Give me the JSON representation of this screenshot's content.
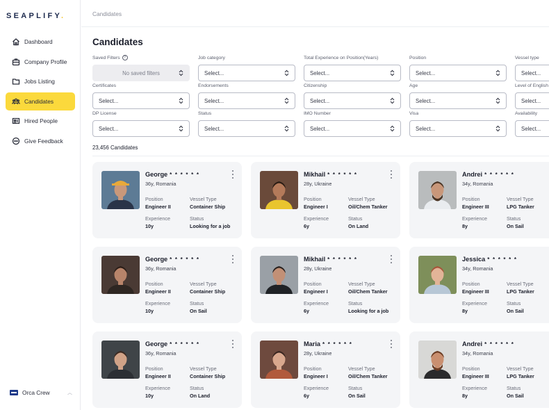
{
  "brand": {
    "name": "SEAPLIFY",
    "dot": "."
  },
  "sidebar": {
    "items": [
      {
        "label": "Dashboard",
        "icon": "home-icon"
      },
      {
        "label": "Company Profile",
        "icon": "briefcase-icon"
      },
      {
        "label": "Jobs Listing",
        "icon": "folder-icon"
      },
      {
        "label": "Candidates",
        "icon": "users-icon",
        "active": true
      },
      {
        "label": "Hired People",
        "icon": "id-card-icon"
      },
      {
        "label": "Give Feedback",
        "icon": "chat-bubble-icon"
      }
    ],
    "org": {
      "name": "Orca Crew",
      "logo": "orca-crew-logo"
    }
  },
  "breadcrumb": "Candidates",
  "page_title": "Candidates",
  "filters": {
    "saved": {
      "label": "Saved Filters",
      "value": "No saved filters"
    },
    "job_category": {
      "label": "Job category",
      "value": "Select..."
    },
    "total_experience": {
      "label": "Total Experience on Position(Years)",
      "value": "Select..."
    },
    "position": {
      "label": "Position",
      "value": "Select..."
    },
    "vessel_type": {
      "label": "Vessel type",
      "value": "Select..."
    },
    "certificates": {
      "label": "Certificates",
      "value": "Select..."
    },
    "endorsements": {
      "label": "Endorsements",
      "value": "Select..."
    },
    "citizenship": {
      "label": "Citizenship",
      "value": "Select..."
    },
    "age": {
      "label": "Age",
      "value": "Select..."
    },
    "english": {
      "label": "Level of English",
      "value": "Select..."
    },
    "dp_license": {
      "label": "DP License",
      "value": "Select..."
    },
    "status": {
      "label": "Status",
      "value": "Select..."
    },
    "imo_number": {
      "label": "IMO Number",
      "value": "Select..."
    },
    "visa": {
      "label": "Visa",
      "value": "Select..."
    },
    "availability": {
      "label": "Availability",
      "value": "Select..."
    }
  },
  "candidates_count": "23,456 Candidates",
  "field_labels": {
    "position": "Position",
    "vessel": "Vessel Type",
    "experience": "Experience",
    "status": "Status"
  },
  "mask": "* * * * * *",
  "candidates": [
    {
      "name": "George",
      "meta": "36y, Romania",
      "position": "Engineer II",
      "vessel": "Container Ship",
      "experience": "10y",
      "status": "Looking for a job"
    },
    {
      "name": "Mikhail",
      "meta": "28y, Ukraine",
      "position": "Engineer I",
      "vessel": "Oil/Chem Tanker",
      "experience": "6y",
      "status": "On Land"
    },
    {
      "name": "Andrei",
      "meta": "34y, Romania",
      "position": "Engineer III",
      "vessel": "LPG Tanker",
      "experience": "8y",
      "status": "On Sail"
    },
    {
      "name": "George",
      "meta": "36y, Romania",
      "position": "Engineer II",
      "vessel": "Container Ship",
      "experience": "10y",
      "status": "On Sail"
    },
    {
      "name": "Mikhail",
      "meta": "28y, Ukraine",
      "position": "Engineer I",
      "vessel": "Oil/Chem Tanker",
      "experience": "6y",
      "status": "Looking for a job"
    },
    {
      "name": "Jessica",
      "meta": "34y, Romania",
      "position": "Engineer III",
      "vessel": "LPG Tanker",
      "experience": "8y",
      "status": "On Sail"
    },
    {
      "name": "George",
      "meta": "36y, Romania",
      "position": "Engineer II",
      "vessel": "Container Ship",
      "experience": "10y",
      "status": "On Land"
    },
    {
      "name": "Maria",
      "meta": "28y, Ukraine",
      "position": "Engineer I",
      "vessel": "Oil/Chem Tanker",
      "experience": "6y",
      "status": "On Sail"
    },
    {
      "name": "Andrei",
      "meta": "34y, Romania",
      "position": "Engineer III",
      "vessel": "LPG Tanker",
      "experience": "8y",
      "status": "On Sail"
    }
  ]
}
